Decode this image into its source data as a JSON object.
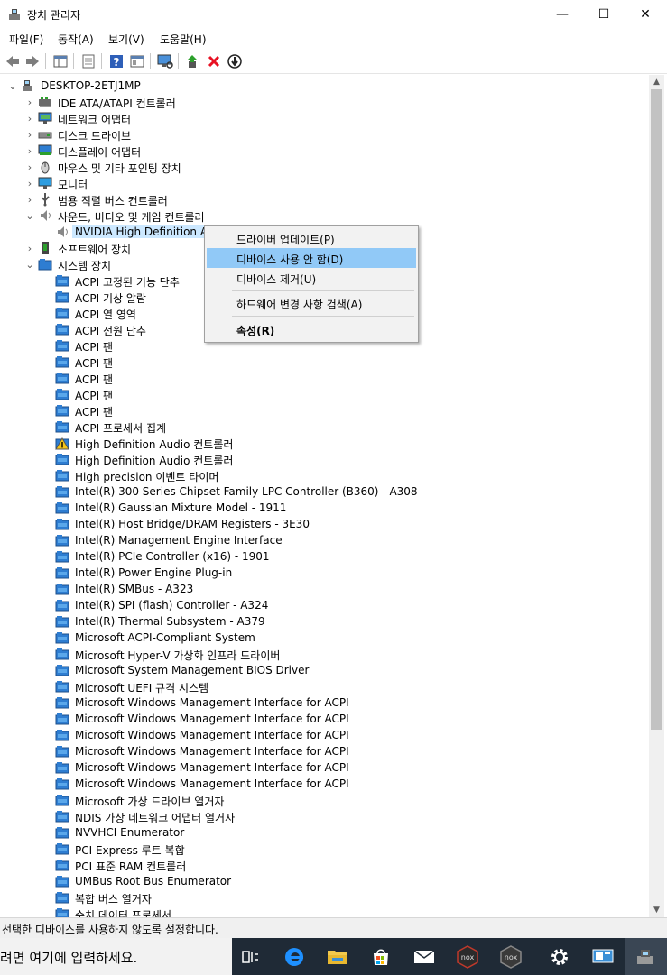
{
  "window": {
    "title": "장치 관리자",
    "minimize_label": "—",
    "maximize_label": "☐",
    "close_label": "✕"
  },
  "menu": [
    "파일(F)",
    "동작(A)",
    "보기(V)",
    "도움말(H)"
  ],
  "tree": {
    "root": "DESKTOP-2ETJ1MP",
    "categories": [
      "IDE ATA/ATAPI 컨트롤러",
      "네트워크 어댑터",
      "디스크 드라이브",
      "디스플레이 어댑터",
      "마우스 및 기타 포인팅 장치",
      "모니터",
      "범용 직렬 버스 컨트롤러",
      "사운드, 비디오 및 게임 컨트롤러",
      "NVIDIA High Definition Au",
      "소프트웨어 장치",
      "시스템 장치"
    ],
    "system_devices": [
      "ACPI 고정된 기능 단추",
      "ACPI 기상 알람",
      "ACPI 열 영역",
      "ACPI 전원 단추",
      "ACPI 팬",
      "ACPI 팬",
      "ACPI 팬",
      "ACPI 팬",
      "ACPI 팬",
      "ACPI 프로세서 집계",
      "High Definition Audio 컨트롤러",
      "High Definition Audio 컨트롤러",
      "High precision 이벤트 타이머",
      "Intel(R) 300 Series Chipset Family LPC Controller (B360) - A308",
      "Intel(R) Gaussian Mixture Model - 1911",
      "Intel(R) Host Bridge/DRAM Registers - 3E30",
      "Intel(R) Management Engine Interface",
      "Intel(R) PCIe Controller (x16) - 1901",
      "Intel(R) Power Engine Plug-in",
      "Intel(R) SMBus - A323",
      "Intel(R) SPI (flash) Controller - A324",
      "Intel(R) Thermal Subsystem - A379",
      "Microsoft ACPI-Compliant System",
      "Microsoft Hyper-V 가상화 인프라 드라이버",
      "Microsoft System Management BIOS Driver",
      "Microsoft UEFI 규격 시스템",
      "Microsoft Windows Management Interface for ACPI",
      "Microsoft Windows Management Interface for ACPI",
      "Microsoft Windows Management Interface for ACPI",
      "Microsoft Windows Management Interface for ACPI",
      "Microsoft Windows Management Interface for ACPI",
      "Microsoft Windows Management Interface for ACPI",
      "Microsoft 가상 드라이브 열거자",
      "NDIS 가상 네트워크 어댑터 열거자",
      "NVVHCI Enumerator",
      "PCI Express 루트 복합",
      "PCI 표준 RAM 컨트롤러",
      "UMBus Root Bus Enumerator",
      "복합 버스 열거자",
      "수치 데이터 프로세서"
    ]
  },
  "context_menu": {
    "update_driver": "드라이버 업데이트(P)",
    "disable": "디바이스 사용 안 함(D)",
    "uninstall": "디바이스 제거(U)",
    "scan": "하드웨어 변경 사항 검색(A)",
    "properties": "속성(R)"
  },
  "status": "선택한 디바이스를 사용하지 않도록 설정합니다.",
  "taskbar": {
    "search_placeholder": "려면 여기에 입력하세요."
  },
  "colors": {
    "selection": "#cce8ff",
    "menu_highlight": "#91c9f7",
    "taskbar": "#1f2a36",
    "disable_icon": "#e81123"
  }
}
